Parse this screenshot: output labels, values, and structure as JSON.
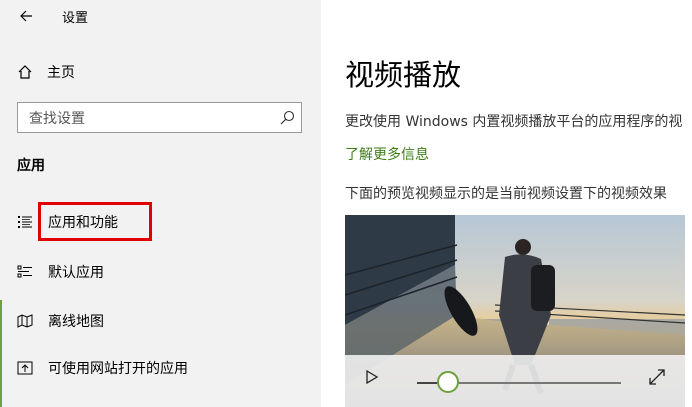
{
  "window": {
    "title": "设置"
  },
  "sidebar": {
    "home_label": "主页",
    "search": {
      "placeholder": "查找设置"
    },
    "section_heading": "应用",
    "items": [
      {
        "label": "应用和功能",
        "icon": "list-icon",
        "highlighted": true
      },
      {
        "label": "默认应用",
        "icon": "default-apps-icon"
      },
      {
        "label": "离线地图",
        "icon": "offline-map-icon"
      },
      {
        "label": "可使用网站打开的应用",
        "icon": "open-with-website-icon"
      }
    ],
    "highlight_color": "#e10000"
  },
  "main": {
    "title": "视频播放",
    "description": "更改使用 Windows 内置视频播放平台的应用程序的视",
    "link": "了解更多信息",
    "preview_description": "下面的预览视频显示的是当前视频设置下的视频效果",
    "video": {
      "progress": 0.15,
      "controls": [
        "play-icon",
        "seek-slider",
        "fullscreen-icon"
      ]
    },
    "link_color": "#3e7d17"
  },
  "accent_color": "#6ea13c"
}
